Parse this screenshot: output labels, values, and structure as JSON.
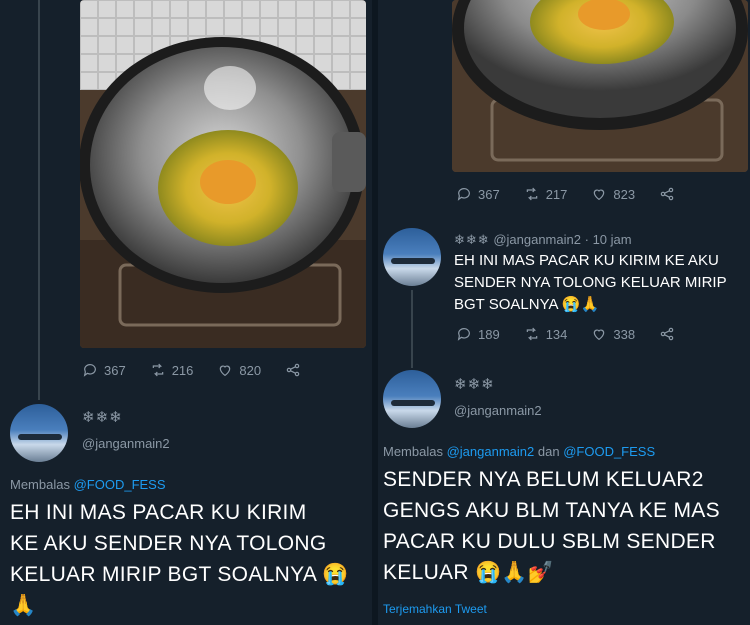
{
  "left": {
    "photo_actions": {
      "replies": "367",
      "retweets": "216",
      "likes": "820"
    },
    "tweet": {
      "handle": "@janganmain2",
      "reply_prefix": "Membalas",
      "reply_to": "@FOOD_FESS",
      "text_lines": [
        "EH INI MAS PACAR KU KIRIM",
        "KE AKU SENDER NYA TOLONG",
        "KELUAR MIRIP BGT SOALNYA 😭",
        "🙏"
      ]
    }
  },
  "right": {
    "photo_actions": {
      "replies": "367",
      "retweets": "217",
      "likes": "823"
    },
    "reply1": {
      "handle": "@janganmain2",
      "time": "10 jam",
      "text_lines": [
        "EH INI MAS PACAR KU KIRIM KE AKU",
        "SENDER NYA TOLONG KELUAR MIRIP",
        "BGT SOALNYA 😭🙏"
      ],
      "actions": {
        "replies": "189",
        "retweets": "134",
        "likes": "338"
      }
    },
    "reply2": {
      "handle": "@janganmain2",
      "reply_prefix": "Membalas",
      "reply_to_1": "@janganmain2",
      "reply_and": "dan",
      "reply_to_2": "@FOOD_FESS",
      "text_lines": [
        "SENDER NYA BELUM KELUAR2",
        "GENGS AKU BLM TANYA KE MAS",
        "PACAR KU DULU SBLM SENDER",
        "KELUAR 😭🙏💅"
      ],
      "translate": "Terjemahkan Tweet"
    }
  },
  "colors": {
    "background": "#15202b",
    "link": "#1d9bf0",
    "muted": "#8b98a5"
  }
}
